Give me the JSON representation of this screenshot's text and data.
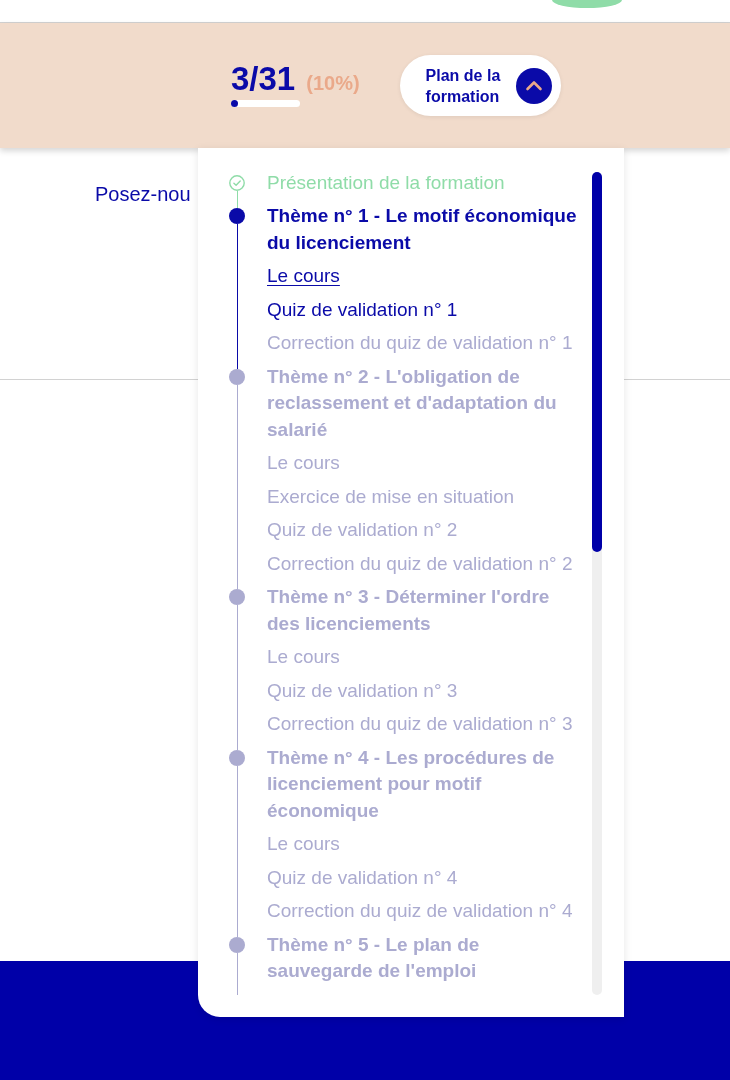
{
  "progress": {
    "count": "3/31",
    "percent": "(10%)",
    "level": 0.1
  },
  "plan_button": {
    "label": "Plan de la formation",
    "expanded": true
  },
  "page": {
    "question": "Posez-nou"
  },
  "plan": {
    "sections": [
      {
        "kind": "intro",
        "title": "Présentation de la formation",
        "completed": true,
        "active": false
      },
      {
        "kind": "theme",
        "title": "Thème n° 1 - Le motif économique du licenciement",
        "completed": false,
        "active": true,
        "children": [
          {
            "label": "Le cours",
            "selected": true,
            "locked": false
          },
          {
            "label": "Quiz de validation n° 1",
            "selected": false,
            "locked": false
          },
          {
            "label": "Correction du quiz de validation n° 1",
            "selected": false,
            "locked": true
          }
        ]
      },
      {
        "kind": "theme",
        "title": "Thème n° 2 - L'obligation de reclassement et d'adaptation du salarié",
        "completed": false,
        "active": false,
        "children": [
          {
            "label": "Le cours",
            "selected": false,
            "locked": true
          },
          {
            "label": "Exercice de mise en situation",
            "selected": false,
            "locked": true
          },
          {
            "label": "Quiz de validation n° 2",
            "selected": false,
            "locked": true
          },
          {
            "label": "Correction du quiz de validation n° 2",
            "selected": false,
            "locked": true
          }
        ]
      },
      {
        "kind": "theme",
        "title": "Thème n° 3 - Déterminer l'ordre des licenciements",
        "completed": false,
        "active": false,
        "children": [
          {
            "label": "Le cours",
            "selected": false,
            "locked": true
          },
          {
            "label": "Quiz de validation n° 3",
            "selected": false,
            "locked": true
          },
          {
            "label": "Correction du quiz de validation n° 3",
            "selected": false,
            "locked": true
          }
        ]
      },
      {
        "kind": "theme",
        "title": "Thème n° 4 - Les procédures de licenciement pour motif économique",
        "completed": false,
        "active": false,
        "children": [
          {
            "label": "Le cours",
            "selected": false,
            "locked": true
          },
          {
            "label": "Quiz de validation n° 4",
            "selected": false,
            "locked": true
          },
          {
            "label": "Correction du quiz de validation n° 4",
            "selected": false,
            "locked": true
          }
        ]
      },
      {
        "kind": "theme",
        "title": "Thème n° 5 - Le plan de sauvegarde de l'emploi",
        "completed": false,
        "active": false
      }
    ]
  }
}
